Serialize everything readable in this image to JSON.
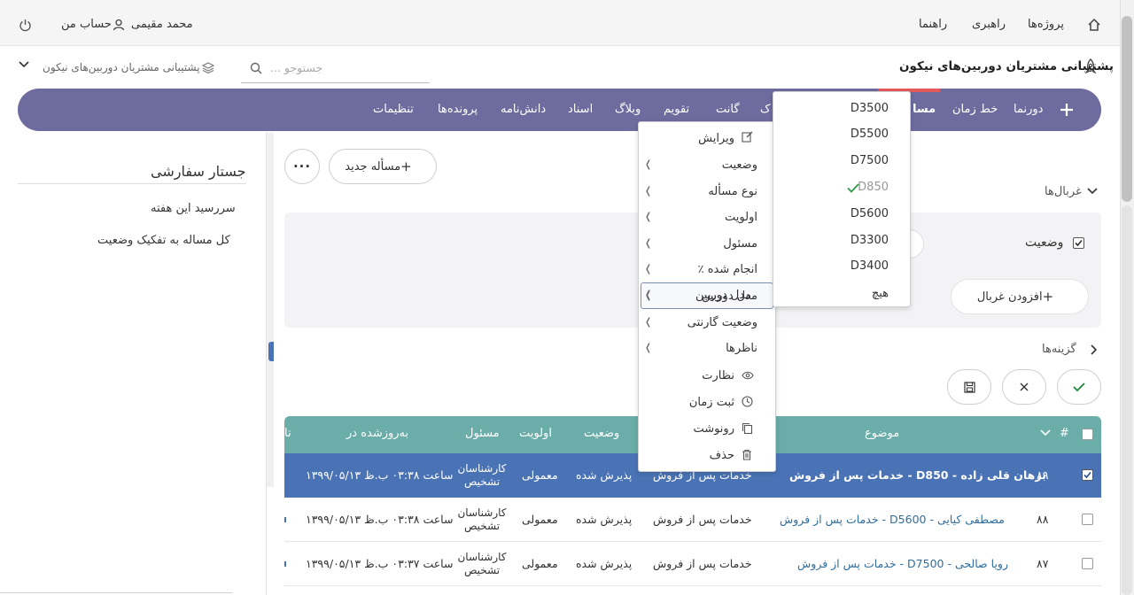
{
  "topbar": {
    "nav": [
      "پروژه‌ها",
      "راهبری",
      "راهنما"
    ],
    "user_name": "محمد مقیمی",
    "account": "حساب من"
  },
  "project": {
    "title": "پشتیبانی مشتریان دوربین‌های نیکون",
    "search_placeholder": "... جستوجو",
    "selector_label": "پشتیبانی مشتریان دوربین‌های نیکون"
  },
  "mainnav": {
    "tabs": [
      "دورنما",
      "خط زمان",
      "مسا",
      "ک",
      "گانت",
      "تقویم",
      "وبلاگ",
      "اسناد",
      "دانش‌نامه",
      "پرونده‌ها",
      "تنظیمات"
    ],
    "accent": "#6e6b9e"
  },
  "toolbar": {
    "new_issue": "مسأله جدید"
  },
  "filters": {
    "heading": "غربال‌ها",
    "status_label": "وضعیت",
    "add_filter": "افزودن غربال"
  },
  "options": {
    "heading": "گزینه‌ها"
  },
  "sidebar": {
    "title": "جستار سفارشی",
    "items": [
      "سررسید این هفته",
      "کل مساله به تفکیک وضعیت"
    ]
  },
  "table": {
    "headers": [
      "#",
      "موضوع",
      "وضعیت",
      "اولویت",
      "مسئول",
      "به‌روزشده در",
      "تا"
    ],
    "rows": [
      {
        "id": "۸۹",
        "subject": "خدمات پس از فروش - D850 - برهان قلی زاده",
        "tracker": "خدمات پس از فروش",
        "status": "پذیرش شده",
        "priority": "معمولی",
        "assignee": "کارشناسان تشخیص",
        "updated": "۱۳۹۹/۰۵/۱۳ ساعت ۰۳:۳۸ ب.ظ",
        "checked": true
      },
      {
        "id": "۸۸",
        "subject": "خدمات پس از فروش - D5600 - مصطفی کیایی",
        "tracker": "خدمات پس از فروش",
        "status": "پذیرش شده",
        "priority": "معمولی",
        "assignee": "کارشناسان تشخیص",
        "updated": "۱۳۹۹/۰۵/۱۳ ساعت ۰۳:۳۸ ب.ظ",
        "checked": false
      },
      {
        "id": "۸۷",
        "subject": "خدمات پس از فروش - D7500 - رویا صالحی",
        "tracker": "خدمات پس از فروش",
        "status": "پذیرش شده",
        "priority": "معمولی",
        "assignee": "کارشناسان تشخیص",
        "updated": "۱۳۹۹/۰۵/۱۳ ساعت ۰۳:۳۷ ب.ظ",
        "checked": false
      }
    ],
    "head_color": "#6aada9",
    "selected_color": "#4a73b5"
  },
  "context_menu": {
    "items": [
      "ویرایش",
      "وضعیت",
      "نوع مسأله",
      "اولویت",
      "مسئول",
      "٪ انجام شده",
      "مدل دوربین",
      "وضعیت گارنتی",
      "ناظرها",
      "نظارت",
      "ثبت زمان",
      "رونوشت",
      "حذف"
    ]
  },
  "submenu": {
    "items": [
      "D3500",
      "D5500",
      "D7500",
      "D850",
      "D5600",
      "D3300",
      "D3400",
      "هیچ"
    ],
    "selected": "D850"
  }
}
